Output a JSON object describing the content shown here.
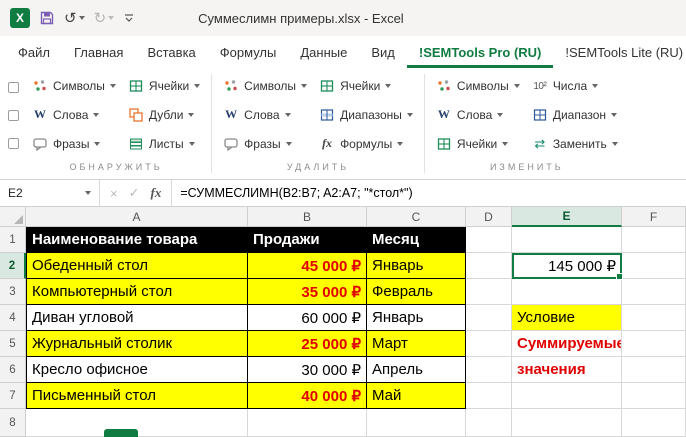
{
  "colors": {
    "accent_green": "#107C41",
    "highlight_yellow": "#FFFF00",
    "alert_red": "#E00000",
    "header_black": "#000000"
  },
  "icons": {
    "excel_logo": "X",
    "undo": "↺",
    "redo": "↻",
    "cancel": "×",
    "enter": "✓",
    "insert_function": "fx",
    "words": "W",
    "formulas": "fx",
    "numbers": "10²",
    "replace": "⇄"
  },
  "titlebar": {
    "title": "Суммеслимн примеры.xlsx - Excel"
  },
  "tabs": {
    "items": [
      {
        "label": "Файл"
      },
      {
        "label": "Главная"
      },
      {
        "label": "Вставка"
      },
      {
        "label": "Формулы"
      },
      {
        "label": "Данные"
      },
      {
        "label": "Вид"
      },
      {
        "label": "!SEMTools Pro (RU)"
      },
      {
        "label": "!SEMTools Lite (RU)"
      }
    ]
  },
  "ribbon": {
    "groups": [
      {
        "label": "ОБНАРУЖИТЬ",
        "buttons": [
          {
            "label": "Символы"
          },
          {
            "label": "Слова"
          },
          {
            "label": "Фразы"
          },
          {
            "label": "Ячейки"
          },
          {
            "label": "Дубли"
          },
          {
            "label": "Листы"
          }
        ]
      },
      {
        "label": "УДАЛИТЬ",
        "buttons": [
          {
            "label": "Символы"
          },
          {
            "label": "Слова"
          },
          {
            "label": "Фразы"
          },
          {
            "label": "Ячейки"
          },
          {
            "label": "Диапазоны"
          },
          {
            "label": "Формулы"
          }
        ]
      },
      {
        "label": "ИЗМЕНИТЬ",
        "buttons": [
          {
            "label": "Символы"
          },
          {
            "label": "Слова"
          },
          {
            "label": "Ячейки"
          },
          {
            "label": "Числа"
          },
          {
            "label": "Диапазон"
          },
          {
            "label": "Заменить"
          }
        ]
      }
    ]
  },
  "formula_bar": {
    "name_box": "E2",
    "formula": "=СУММЕСЛИМН(B2:B7; A2:A7; \"*стол*\")"
  },
  "sheet": {
    "col_headers": [
      "A",
      "B",
      "C",
      "D",
      "E",
      "F"
    ],
    "row_headers": [
      "1",
      "2",
      "3",
      "4",
      "5",
      "6",
      "7",
      "8"
    ],
    "table": {
      "header": {
        "name": "Наименование товара",
        "sales": "Продажи",
        "month": "Месяц"
      },
      "rows": [
        {
          "name": "Обеденный стол",
          "sales": "45 000 ₽",
          "month": "Январь"
        },
        {
          "name": "Компьютерный стол",
          "sales": "35 000 ₽",
          "month": "Февраль"
        },
        {
          "name": "Диван угловой",
          "sales": "60 000 ₽",
          "month": "Январь"
        },
        {
          "name": "Журнальный столик",
          "sales": "25 000 ₽",
          "month": "Март"
        },
        {
          "name": "Кресло офисное",
          "sales": "30 000 ₽",
          "month": "Апрель"
        },
        {
          "name": "Письменный стол",
          "sales": "40 000 ₽",
          "month": "Май"
        }
      ]
    },
    "result_cell": "145 000 ₽",
    "labels": {
      "condition": "Условие",
      "sum_line1": "Суммируемые",
      "sum_line2": "значения"
    }
  }
}
